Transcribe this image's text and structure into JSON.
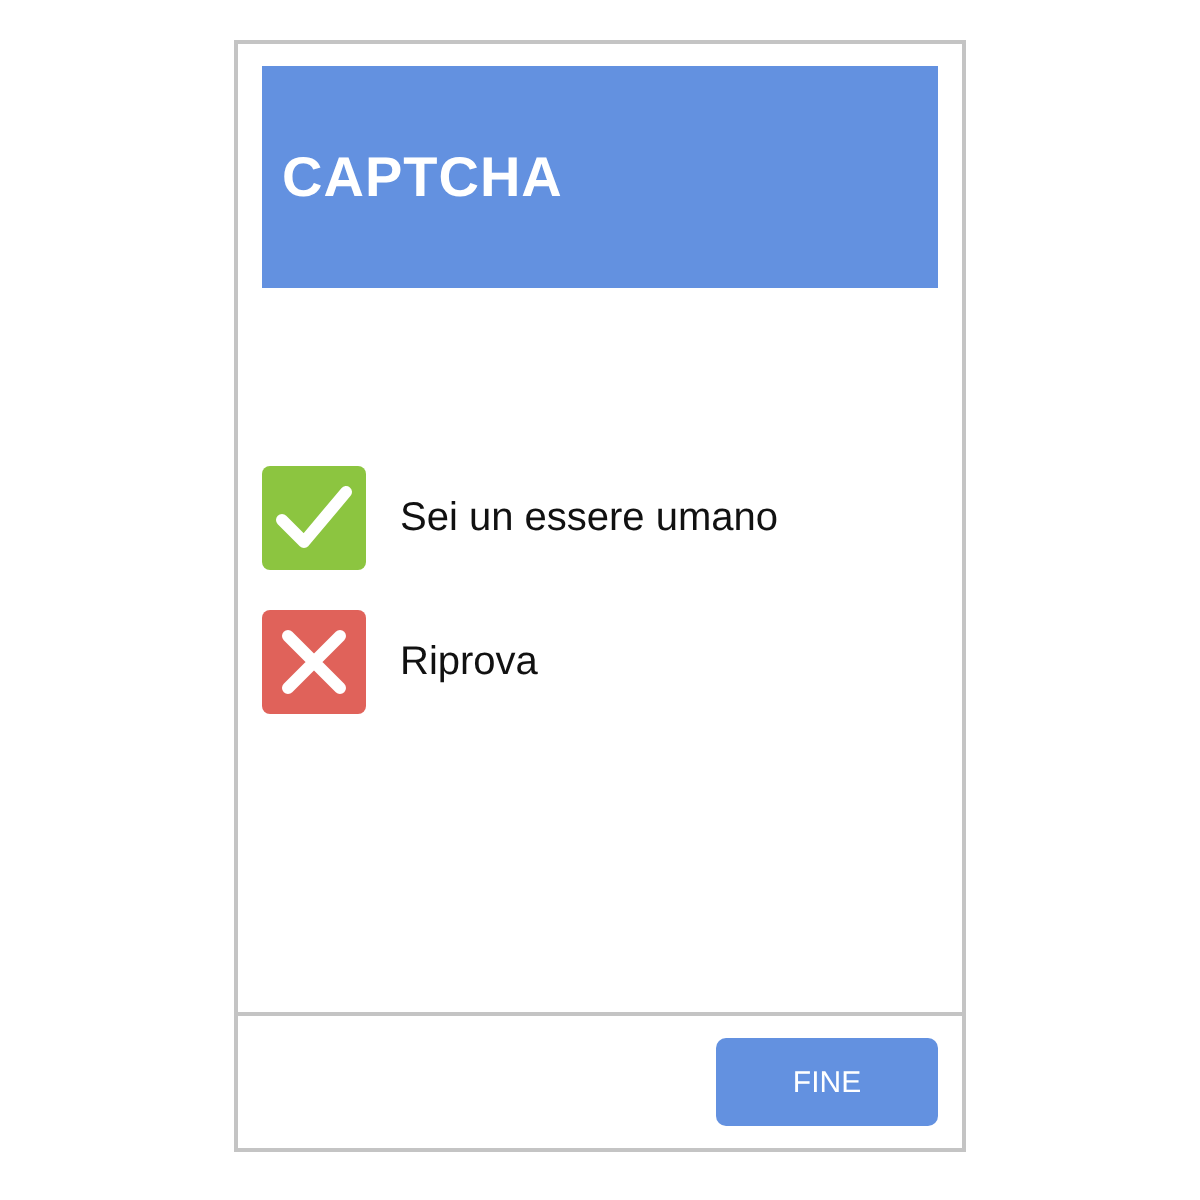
{
  "header": {
    "title": "CAPTCHA"
  },
  "options": [
    {
      "kind": "check",
      "label": "Sei un essere umano"
    },
    {
      "kind": "cross",
      "label": "Riprova"
    }
  ],
  "footer": {
    "button": "FINE"
  }
}
